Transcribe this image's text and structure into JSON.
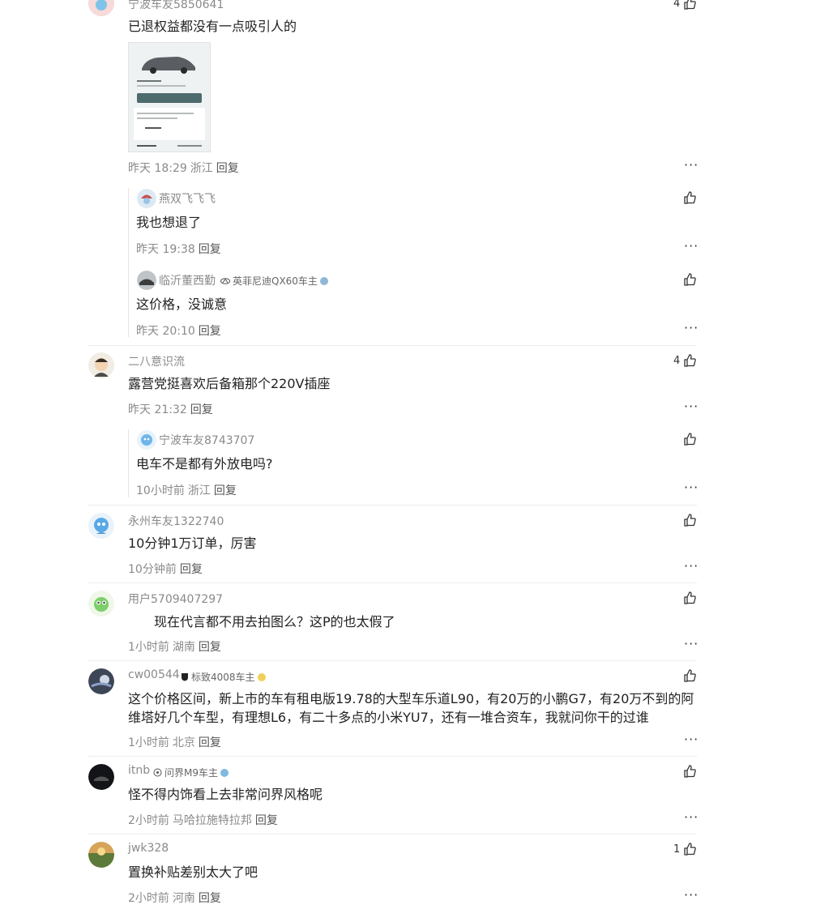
{
  "colors": {
    "muted": "#8a8a8a",
    "text": "#222222",
    "divider": "#ededed"
  },
  "comments": [
    {
      "user": "宁波车友5850641",
      "content": "已退权益都没有一点吸引人的",
      "time": "昨天 18:29",
      "location": "浙江",
      "reply_label": "回复",
      "likes": "4",
      "has_image": true,
      "replies": [
        {
          "user": "燕双飞飞飞",
          "content": "我也想退了",
          "time": "昨天 19:38",
          "reply_label": "回复"
        },
        {
          "user": "临沂董西勤",
          "badge": "英菲尼迪QX60车主",
          "content": "这价格，没诚意",
          "time": "昨天 20:10",
          "reply_label": "回复"
        }
      ]
    },
    {
      "user": "二八意识流",
      "content": "露营党挺喜欢后备箱那个220V插座",
      "time": "昨天 21:32",
      "reply_label": "回复",
      "likes": "4",
      "replies": [
        {
          "user": "宁波车友8743707",
          "content": "电车不是都有外放电吗?",
          "time": "10小时前",
          "location": "浙江",
          "reply_label": "回复"
        }
      ]
    },
    {
      "user": "永州车友1322740",
      "content": "10分钟1万订单，厉害",
      "time": "10分钟前",
      "reply_label": "回复"
    },
    {
      "user": "用户5709407297",
      "content": "现在代言都不用去拍图么？这P的也太假了",
      "time": "1小时前",
      "location": "湖南",
      "reply_label": "回复"
    },
    {
      "user": "cw00544",
      "badge": "标致4008车主",
      "content_line1": "这个价格区间，新上市的车有租电版19.78的大型车乐道L90，有20万的小鹏G7，有20万不到的阿",
      "content_line2": "维塔好几个车型，有理想L6，有二十多点的小米YU7，还有一堆合资车，我就问你干的过谁",
      "time": "1小时前",
      "location": "北京",
      "reply_label": "回复"
    },
    {
      "user": "itnb",
      "badge": "问界M9车主",
      "content": "怪不得内饰看上去非常问界风格呢",
      "time": "2小时前",
      "location": "马哈拉施特拉邦",
      "reply_label": "回复"
    },
    {
      "user": "jwk328",
      "content": "置换补贴差别太大了吧",
      "time": "2小时前",
      "location": "河南",
      "reply_label": "回复",
      "likes": "1"
    }
  ],
  "icons": {
    "like": "thumbs-up-icon",
    "more": "more-dots-icon"
  },
  "more_glyph": "···"
}
